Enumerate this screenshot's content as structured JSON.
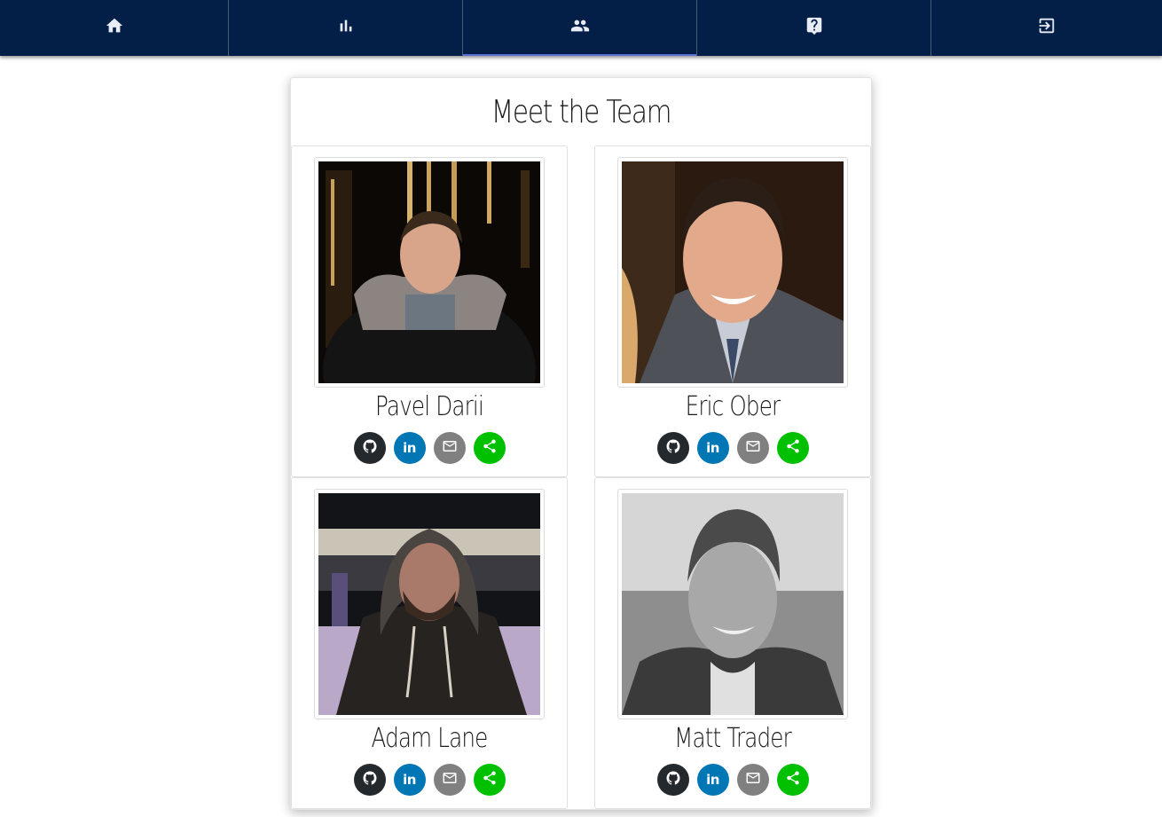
{
  "colors": {
    "nav_bg": "#031e47",
    "nav_active_underline": "#5b6fd6",
    "github": "#24292e",
    "linkedin": "#0077b5",
    "email": "#808080",
    "share": "#00c000"
  },
  "nav": {
    "items": [
      {
        "icon": "home-icon",
        "active": false
      },
      {
        "icon": "bar-chart-icon",
        "active": false
      },
      {
        "icon": "people-icon",
        "active": true
      },
      {
        "icon": "help-icon",
        "active": false
      },
      {
        "icon": "logout-icon",
        "active": false
      }
    ]
  },
  "page": {
    "title": "Meet the Team"
  },
  "team": [
    {
      "name": "Pavel Darii",
      "socials": [
        "github-icon",
        "linkedin-icon",
        "email-icon",
        "share-icon"
      ]
    },
    {
      "name": "Eric Ober",
      "socials": [
        "github-icon",
        "linkedin-icon",
        "email-icon",
        "share-icon"
      ]
    },
    {
      "name": "Adam Lane",
      "socials": [
        "github-icon",
        "linkedin-icon",
        "email-icon",
        "share-icon"
      ]
    },
    {
      "name": "Matt Trader",
      "socials": [
        "github-icon",
        "linkedin-icon",
        "email-icon",
        "share-icon"
      ]
    }
  ],
  "social_labels": {
    "linkedin": "in"
  }
}
